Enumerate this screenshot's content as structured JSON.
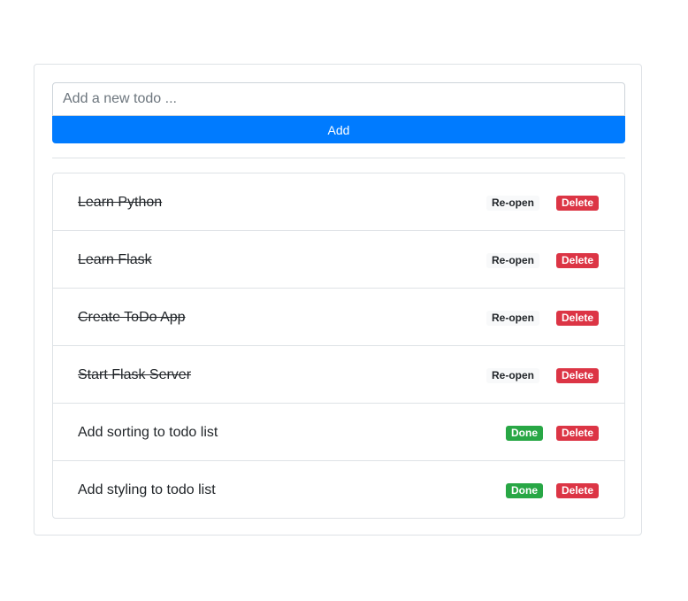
{
  "form": {
    "placeholder": "Add a new todo ...",
    "value": "",
    "add_label": "Add"
  },
  "todos": [
    {
      "text": "Learn Python",
      "completed": true,
      "toggle_label": "Re-open",
      "delete_label": "Delete"
    },
    {
      "text": "Learn Flask",
      "completed": true,
      "toggle_label": "Re-open",
      "delete_label": "Delete"
    },
    {
      "text": "Create ToDo App",
      "completed": true,
      "toggle_label": "Re-open",
      "delete_label": "Delete"
    },
    {
      "text": "Start Flask Server",
      "completed": true,
      "toggle_label": "Re-open",
      "delete_label": "Delete"
    },
    {
      "text": "Add sorting to todo list",
      "completed": false,
      "toggle_label": "Done",
      "delete_label": "Delete"
    },
    {
      "text": "Add styling to todo list",
      "completed": false,
      "toggle_label": "Done",
      "delete_label": "Delete"
    }
  ],
  "colors": {
    "primary": "#007bff",
    "danger": "#dc3545",
    "success": "#28a745",
    "light": "#f8f9fa",
    "border": "#dee2e6"
  }
}
